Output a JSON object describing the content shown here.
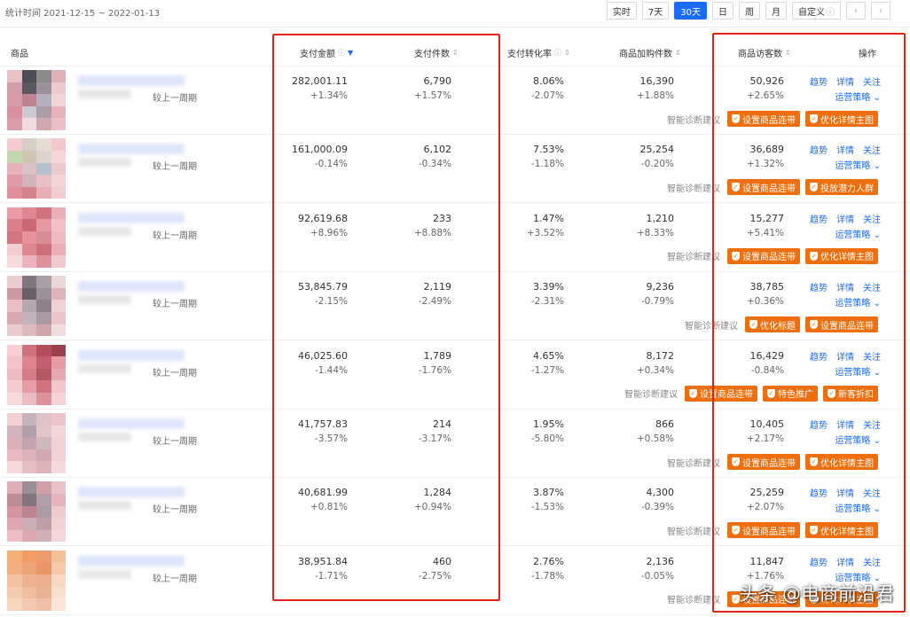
{
  "topbar": {
    "stat_range": "统计时间 2021-12-15 ~ 2022-01-13",
    "periods": [
      "实时",
      "7天",
      "30天",
      "日",
      "周",
      "月",
      "自定义"
    ],
    "active_period": "30天",
    "prev_icon": "chevron-left-icon",
    "next_icon": "chevron-right-icon"
  },
  "headers": {
    "product": "商品",
    "pay_amount": "支付金额",
    "pay_count": "支付件数",
    "conversion": "支付转化率",
    "cart_count": "商品加购件数",
    "visitors": "商品访客数",
    "actions": "操作"
  },
  "compare_label": "较上一周期",
  "suggest_label": "智能诊断建议",
  "ops": {
    "trend": "趋势",
    "detail": "详情",
    "follow": "关注",
    "strategy": "运营策略"
  },
  "rows": [
    {
      "amount": "282,001.11",
      "amount_chg": "+1.34%",
      "count": "6,790",
      "count_chg": "+1.57%",
      "conv": "8.06%",
      "conv_chg": "-2.07%",
      "cart": "16,390",
      "cart_chg": "+1.88%",
      "visitors": "50,926",
      "visitors_chg": "+2.65%",
      "tags": [
        "设置商品连带",
        "优化详情主图"
      ]
    },
    {
      "amount": "161,000.09",
      "amount_chg": "-0.14%",
      "count": "6,102",
      "count_chg": "-0.34%",
      "conv": "7.53%",
      "conv_chg": "-1.18%",
      "cart": "25,254",
      "cart_chg": "-0.20%",
      "visitors": "36,689",
      "visitors_chg": "+1.32%",
      "tags": [
        "设置商品连带",
        "投放潜力人群"
      ]
    },
    {
      "amount": "92,619.68",
      "amount_chg": "+8.96%",
      "count": "233",
      "count_chg": "+8.88%",
      "conv": "1.47%",
      "conv_chg": "+3.52%",
      "cart": "1,210",
      "cart_chg": "+8.33%",
      "visitors": "15,277",
      "visitors_chg": "+5.41%",
      "tags": [
        "设置商品连带",
        "优化详情主图"
      ]
    },
    {
      "amount": "53,845.79",
      "amount_chg": "-2.15%",
      "count": "2,119",
      "count_chg": "-2.49%",
      "conv": "3.39%",
      "conv_chg": "-2.31%",
      "cart": "9,236",
      "cart_chg": "-0.79%",
      "visitors": "38,785",
      "visitors_chg": "+0.36%",
      "tags": [
        "优化标题",
        "设置商品连带"
      ]
    },
    {
      "amount": "46,025.60",
      "amount_chg": "-1.44%",
      "count": "1,789",
      "count_chg": "-1.76%",
      "conv": "4.65%",
      "conv_chg": "-1.27%",
      "cart": "8,172",
      "cart_chg": "+0.34%",
      "visitors": "16,429",
      "visitors_chg": "-0.84%",
      "tags": [
        "设置商品连带",
        "特色推广",
        "新客折扣"
      ]
    },
    {
      "amount": "41,757.83",
      "amount_chg": "-3.57%",
      "count": "214",
      "count_chg": "-3.17%",
      "conv": "1.95%",
      "conv_chg": "-5.80%",
      "cart": "866",
      "cart_chg": "+0.58%",
      "visitors": "10,405",
      "visitors_chg": "+2.17%",
      "tags": [
        "设置商品连带",
        "优化详情主图"
      ]
    },
    {
      "amount": "40,681.99",
      "amount_chg": "+0.81%",
      "count": "1,284",
      "count_chg": "+0.94%",
      "conv": "3.87%",
      "conv_chg": "-1.53%",
      "cart": "4,300",
      "cart_chg": "-0.39%",
      "visitors": "25,259",
      "visitors_chg": "+2.07%",
      "tags": [
        "设置商品连带",
        "优化详情主图"
      ]
    },
    {
      "amount": "38,951.84",
      "amount_chg": "-1.71%",
      "count": "460",
      "count_chg": "-2.75%",
      "conv": "2.76%",
      "conv_chg": "-1.78%",
      "cart": "2,136",
      "cart_chg": "-0.05%",
      "visitors": "11,847",
      "visitors_chg": "+1.76%",
      "tags": [
        "设置商品连带",
        "优化详情主图"
      ]
    }
  ],
  "watermark": "头条 @电商前沿君",
  "colors": {
    "accent": "#1a6cf6",
    "tag": "#ef6f0e",
    "highlight_box": "#e2231a"
  }
}
